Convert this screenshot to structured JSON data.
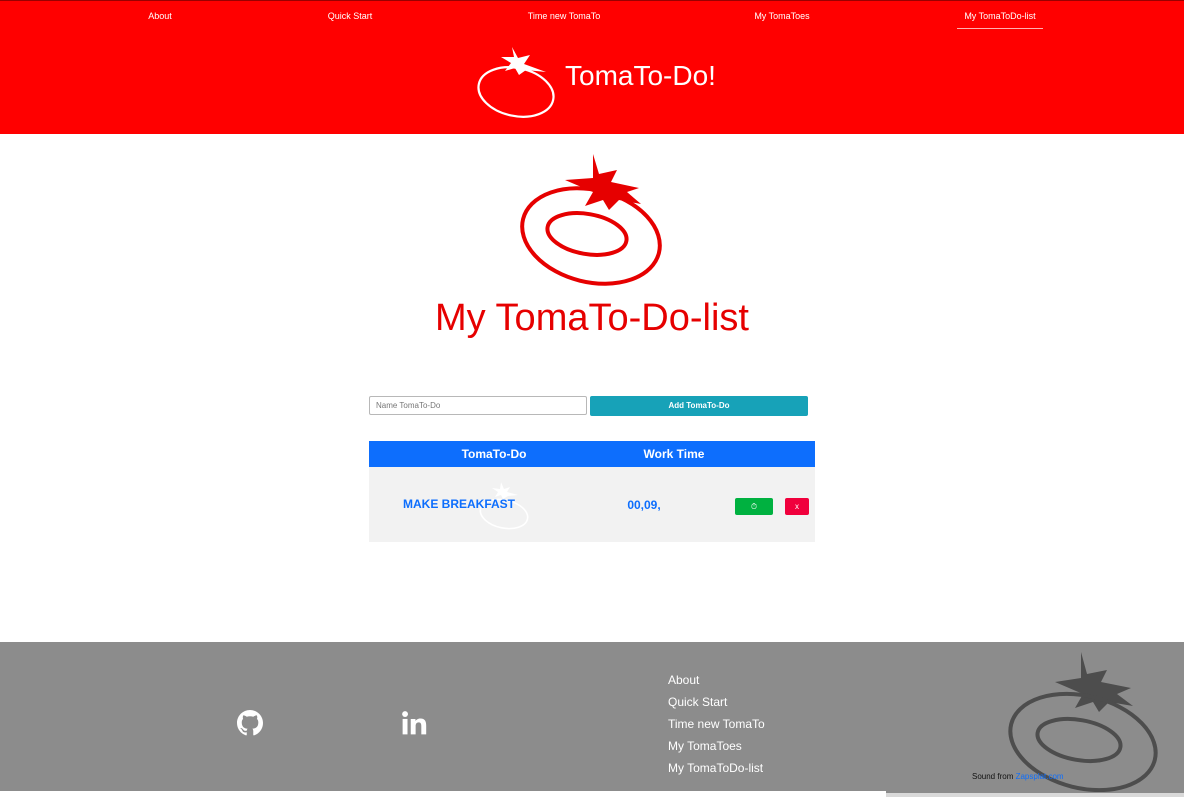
{
  "nav": {
    "items": [
      {
        "label": "About"
      },
      {
        "label": "Quick Start"
      },
      {
        "label": "Time new TomaTo"
      },
      {
        "label": "My TomaToes"
      },
      {
        "label": "My TomaToDo-list"
      }
    ],
    "active_index": 4
  },
  "brand": {
    "title": "TomaTo-Do!"
  },
  "main": {
    "title": "My TomaTo-Do-list",
    "name_input": {
      "placeholder": "Name TomaTo-Do",
      "value": ""
    },
    "add_button_label": "Add TomaTo-Do"
  },
  "table": {
    "columns": [
      "TomaTo-Do",
      "Work Time"
    ],
    "rows": [
      {
        "name": "MAKE BREAKFAST",
        "work_time": "00,09,",
        "start_icon": "timer-icon",
        "start_label": "⏱",
        "delete_label": "x"
      }
    ]
  },
  "footer": {
    "social": [
      {
        "icon": "github-icon"
      },
      {
        "icon": "linkedin-icon"
      }
    ],
    "links": [
      "About",
      "Quick Start",
      "Time new TomaTo",
      "My TomaToes",
      "My TomaToDo-list"
    ],
    "credit_prefix": "Sound from ",
    "credit_link": "Zapsplat.com"
  },
  "colors": {
    "header_bg": "#ff0000",
    "accent_blue": "#0d6efd",
    "add_button": "#17a2b8",
    "start_button": "#00b140",
    "delete_button": "#f0003c",
    "footer_bg": "#8c8c8c"
  }
}
